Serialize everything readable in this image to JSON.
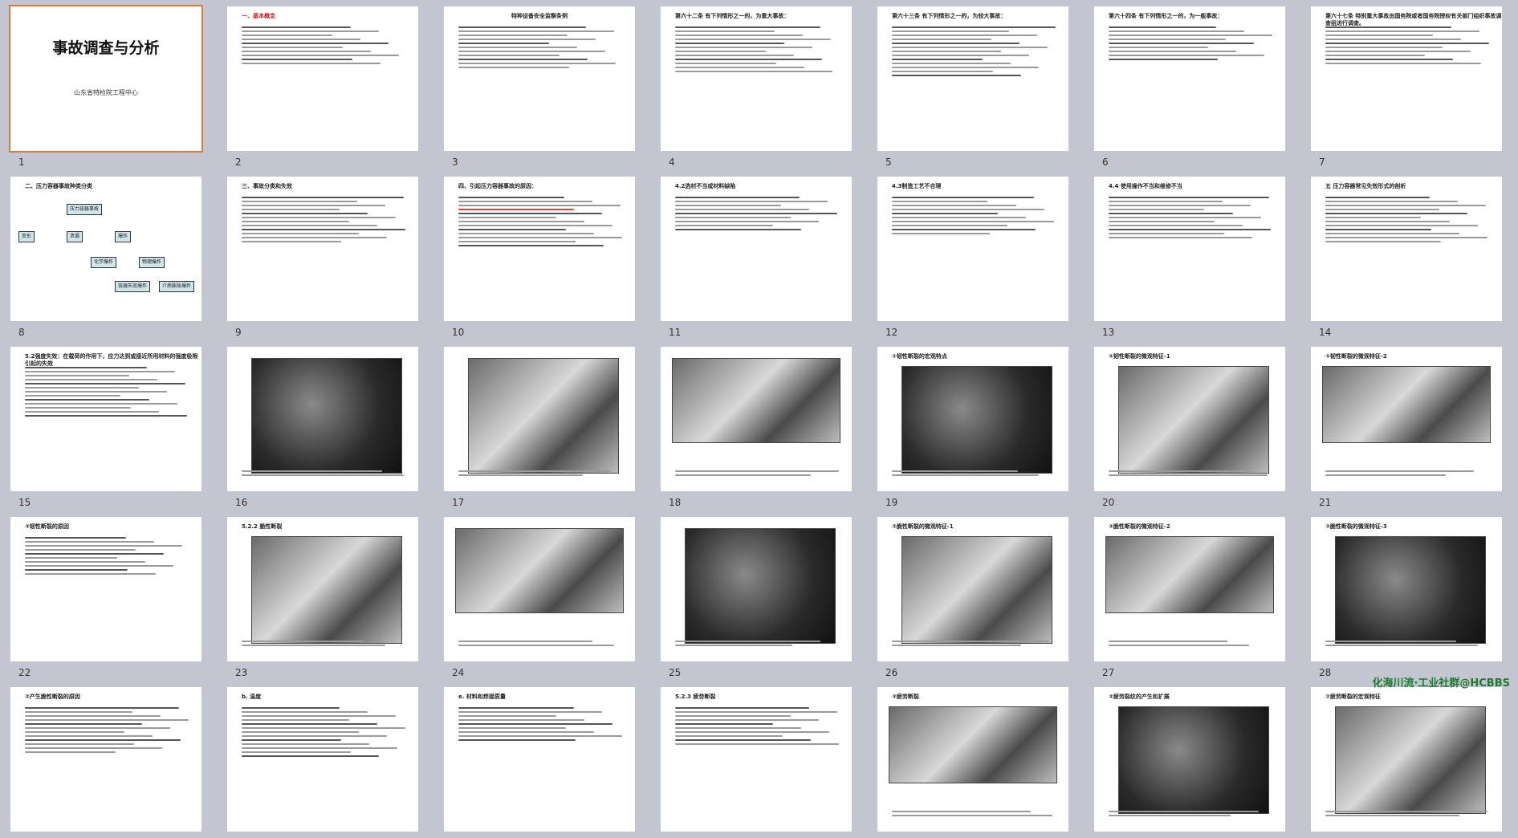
{
  "slides": [
    {
      "n": "1",
      "kind": "cover",
      "title": "事故调查与分析",
      "subtitle": "山东省特检院工程中心"
    },
    {
      "n": "2",
      "kind": "text",
      "title": "一、基本概念",
      "title_red": true
    },
    {
      "n": "3",
      "kind": "text",
      "title": "特种设备安全监察条例",
      "center": true
    },
    {
      "n": "4",
      "kind": "text",
      "title": "第六十二条 有下列情形之一的，为重大事故："
    },
    {
      "n": "5",
      "kind": "text",
      "title": "第六十三条 有下列情形之一的，为较大事故："
    },
    {
      "n": "6",
      "kind": "text",
      "title": "第六十四条 有下列情形之一的，为一般事故："
    },
    {
      "n": "7",
      "kind": "text",
      "title": "第六十七条 特别重大事故由国务院或者国务院授权有关部门组织事故调查组进行调查。"
    },
    {
      "n": "8",
      "kind": "tree",
      "title": "二、压力容器事故种类分类",
      "nodes": [
        "压力容器事故",
        "变形",
        "泄漏",
        "爆炸",
        "化学爆炸",
        "物理爆炸",
        "容器失效爆炸",
        "介质膨胀爆炸"
      ]
    },
    {
      "n": "9",
      "kind": "text",
      "title": "三、事故分类和失效"
    },
    {
      "n": "10",
      "kind": "text",
      "title": "四、引起压力容器事故的原因："
    },
    {
      "n": "11",
      "kind": "text",
      "title": "4.2选材不当或材料缺陷"
    },
    {
      "n": "12",
      "kind": "text",
      "title": "4.3制造工艺不合理"
    },
    {
      "n": "13",
      "kind": "text",
      "title": "4.4 使用操作不当和维修不当"
    },
    {
      "n": "14",
      "kind": "text",
      "title": "五 压力容器常见失效形式的剖析"
    },
    {
      "n": "15",
      "kind": "text",
      "title": "5.2强度失效：在载荷的作用下，应力达到或接近所用材料的强度极限引起的失效"
    },
    {
      "n": "16",
      "kind": "photo",
      "title": ""
    },
    {
      "n": "17",
      "kind": "photo",
      "title": ""
    },
    {
      "n": "18",
      "kind": "photo",
      "title": ""
    },
    {
      "n": "19",
      "kind": "photo",
      "title": "①韧性断裂的宏观特点"
    },
    {
      "n": "20",
      "kind": "photo",
      "title": "①韧性断裂的微观特征-1"
    },
    {
      "n": "21",
      "kind": "photo",
      "title": "①韧性断裂的微观特征-2"
    },
    {
      "n": "22",
      "kind": "text",
      "title": "③韧性断裂的原因"
    },
    {
      "n": "23",
      "kind": "photo",
      "title": "5.2.2 脆性断裂"
    },
    {
      "n": "24",
      "kind": "photo",
      "title": ""
    },
    {
      "n": "25",
      "kind": "photo",
      "title": ""
    },
    {
      "n": "26",
      "kind": "photo",
      "title": "②脆性断裂的微观特征-1"
    },
    {
      "n": "27",
      "kind": "photo",
      "title": "②脆性断裂的微观特征-2"
    },
    {
      "n": "28",
      "kind": "photo",
      "title": "②脆性断裂的微观特征-3"
    },
    {
      "n": "",
      "kind": "text",
      "title": "②产生脆性断裂的原因"
    },
    {
      "n": "",
      "kind": "text",
      "title": "b. 温度"
    },
    {
      "n": "",
      "kind": "text",
      "title": "e. 材料和焊接质量"
    },
    {
      "n": "",
      "kind": "text",
      "title": "5.2.3 疲劳断裂"
    },
    {
      "n": "",
      "kind": "photo",
      "title": "③疲劳断裂"
    },
    {
      "n": "",
      "kind": "photo",
      "title": "②疲劳裂纹的产生和扩展"
    },
    {
      "n": "",
      "kind": "photo",
      "title": "②疲劳断裂的宏观特征"
    }
  ],
  "watermark": "化海川流·工业社群@HCBBS"
}
